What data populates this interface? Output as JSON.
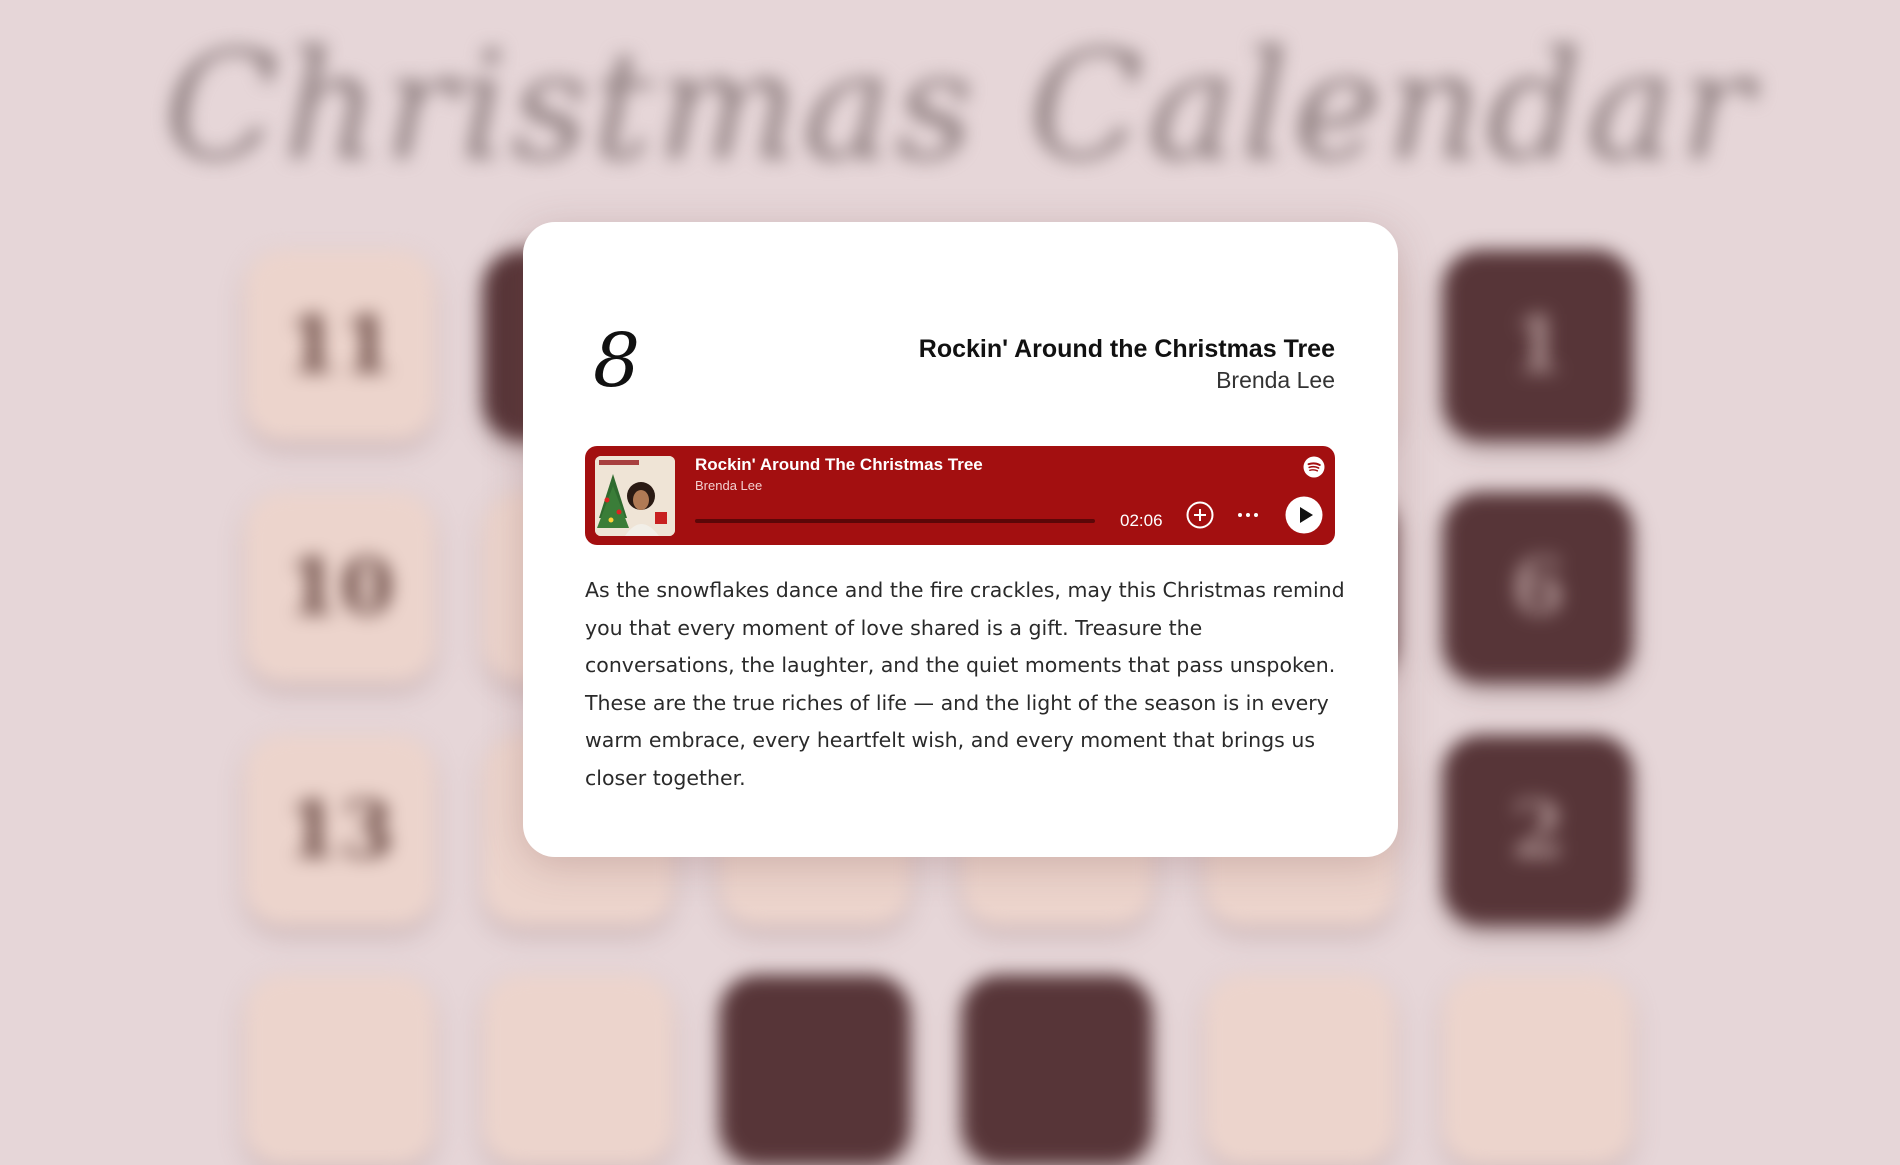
{
  "background": {
    "title": "Christmas Calendar",
    "tiles": [
      {
        "label": "11",
        "style": "light"
      },
      {
        "label": "",
        "style": "dark"
      },
      {
        "label": "",
        "style": "light"
      },
      {
        "label": "",
        "style": "light"
      },
      {
        "label": "",
        "style": "light"
      },
      {
        "label": "1",
        "style": "dark"
      },
      {
        "label": "10",
        "style": "light"
      },
      {
        "label": "",
        "style": "light"
      },
      {
        "label": "",
        "style": "light"
      },
      {
        "label": "",
        "style": "light"
      },
      {
        "label": "",
        "style": "dark"
      },
      {
        "label": "6",
        "style": "dark"
      },
      {
        "label": "13",
        "style": "light"
      },
      {
        "label": "",
        "style": "light"
      },
      {
        "label": "",
        "style": "light"
      },
      {
        "label": "",
        "style": "light"
      },
      {
        "label": "",
        "style": "light"
      },
      {
        "label": "2",
        "style": "dark"
      },
      {
        "label": "",
        "style": "light"
      },
      {
        "label": "",
        "style": "light"
      },
      {
        "label": "",
        "style": "dark"
      },
      {
        "label": "",
        "style": "dark"
      },
      {
        "label": "",
        "style": "light"
      },
      {
        "label": "",
        "style": "light"
      }
    ]
  },
  "modal": {
    "day": "8",
    "song_title": "Rockin' Around the Christmas Tree",
    "artist": "Brenda Lee",
    "message": "As the snowflakes dance and the fire crackles, may this Christmas remind you that every moment of love shared is a gift. Treasure the conversations, the laughter, and the quiet moments that pass unspoken. These are the true riches of life — and the light of the season is in every warm embrace, every heartfelt wish, and every moment that brings us closer together."
  },
  "player": {
    "track": "Rockin' Around The Christmas Tree",
    "artist": "Brenda Lee",
    "time": "02:06",
    "progress": 0,
    "brand_icon": "spotify-icon",
    "colors": {
      "background": "#a30f10",
      "text": "#ffffff"
    }
  }
}
